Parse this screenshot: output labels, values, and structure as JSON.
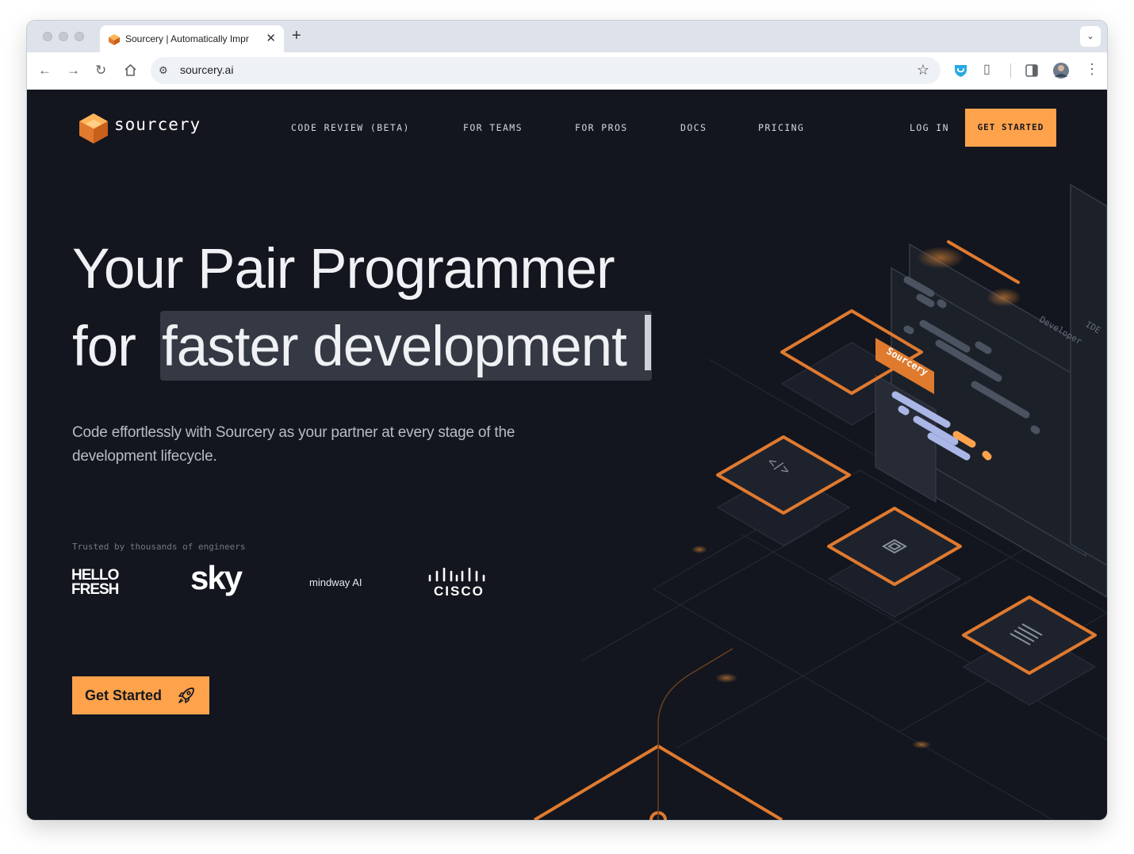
{
  "browser": {
    "tab_title": "Sourcery | Automatically Impr",
    "tab_close": "✕",
    "new_tab": "+",
    "url": "sourcery.ai"
  },
  "colors": {
    "accent": "#ffa24c",
    "background": "#13161e",
    "line": "#e07a2f"
  },
  "header": {
    "brand": "sourcery",
    "nav": [
      "CODE REVIEW (BETA)",
      "FOR TEAMS",
      "FOR PROS",
      "DOCS",
      "PRICING"
    ],
    "login": "LOG IN",
    "cta": "GET STARTED"
  },
  "hero": {
    "line1": "Your Pair Programmer",
    "line2_prefix": "for",
    "line2_highlight": "faster development",
    "subtitle": "Code effortlessly with Sourcery as your partner at every stage of the development lifecycle."
  },
  "trusted": {
    "label": "Trusted by thousands of engineers",
    "logos": {
      "hellofresh_1": "HELLO",
      "hellofresh_2": "FRESH",
      "sky": "sky",
      "mindway": "mindway AI",
      "cisco": "CISCO"
    }
  },
  "cta_button": {
    "label": "Get Started",
    "icon": "rocket-icon"
  },
  "illustration": {
    "tag_sourcery": "Sourcery",
    "tag_developer": "Developer",
    "tag_ide": "IDE",
    "code_glyph": "</>"
  }
}
